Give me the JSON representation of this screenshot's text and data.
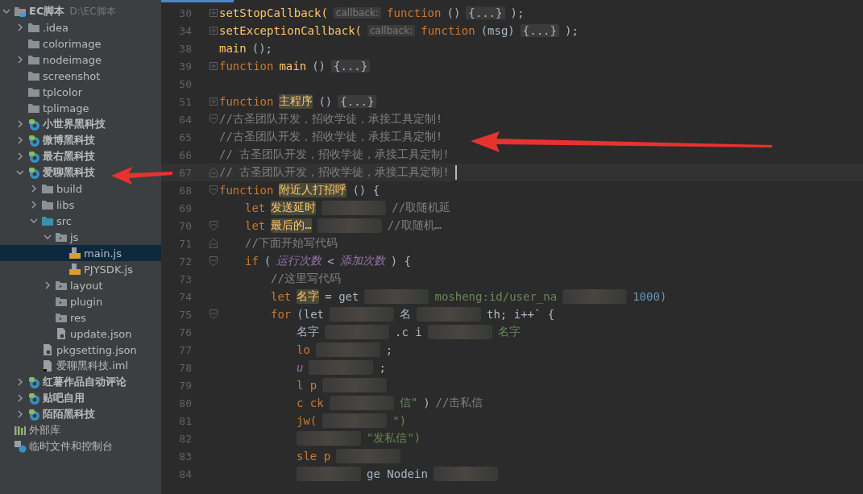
{
  "project_tree": [
    {
      "label": "EC脚本",
      "path": "D:\\EC脚本",
      "kind": "project",
      "expanded": true,
      "children": [
        {
          "label": ".idea",
          "kind": "folder",
          "expanded": false
        },
        {
          "label": "colorimage",
          "kind": "folder"
        },
        {
          "label": "nodeimage",
          "kind": "folder",
          "expanded": false
        },
        {
          "label": "screenshot",
          "kind": "folder"
        },
        {
          "label": "tplcolor",
          "kind": "folder"
        },
        {
          "label": "tplimage",
          "kind": "folder"
        },
        {
          "label": "小世界黑科技",
          "kind": "module",
          "expanded": false
        },
        {
          "label": "微博黑科技",
          "kind": "module",
          "expanded": false
        },
        {
          "label": "最右黑科技",
          "kind": "module",
          "expanded": false
        },
        {
          "label": "爱聊黑科技",
          "kind": "module",
          "expanded": true,
          "children": [
            {
              "label": "build",
              "kind": "folder",
              "expanded": false
            },
            {
              "label": "libs",
              "kind": "folder",
              "expanded": false
            },
            {
              "label": "src",
              "kind": "source",
              "expanded": true,
              "children": [
                {
                  "label": "js",
                  "kind": "package",
                  "expanded": true,
                  "children": [
                    {
                      "label": "main.js",
                      "kind": "js",
                      "selected": true
                    },
                    {
                      "label": "PJYSDK.js",
                      "kind": "js",
                      "selected": false
                    }
                  ]
                },
                {
                  "label": "layout",
                  "kind": "package",
                  "expanded": false
                },
                {
                  "label": "plugin",
                  "kind": "package"
                },
                {
                  "label": "res",
                  "kind": "package"
                },
                {
                  "label": "update.json",
                  "kind": "json"
                }
              ]
            },
            {
              "label": "pkgsetting.json",
              "kind": "json"
            },
            {
              "label": "爱聊黑科技.iml",
              "kind": "iml"
            }
          ]
        },
        {
          "label": "红薯作品自动评论",
          "kind": "module",
          "expanded": false
        },
        {
          "label": "贴吧自用",
          "kind": "module",
          "expanded": false
        },
        {
          "label": "陌陌黑科技",
          "kind": "module",
          "expanded": false
        }
      ]
    },
    {
      "label": "外部库",
      "kind": "library"
    },
    {
      "label": "临时文件和控制台",
      "kind": "scratch"
    }
  ],
  "code_lines": [
    {
      "number": "30",
      "kind": "collapsed",
      "current": false,
      "tokens": [
        {
          "kind": "call",
          "text": "setStopCallback("
        },
        {
          "kind": "hint",
          "text": "callback:"
        },
        {
          "kind": "keyword",
          "text": "function"
        },
        {
          "kind": "plain",
          "text": "()"
        },
        {
          "kind": "folded",
          "text": "{...}"
        },
        {
          "kind": "plain",
          "text": ");"
        }
      ]
    },
    {
      "number": "34",
      "kind": "collapsed",
      "current": false,
      "tokens": [
        {
          "kind": "call",
          "text": "setExceptionCallback("
        },
        {
          "kind": "hint",
          "text": "callback:"
        },
        {
          "kind": "keyword",
          "text": "function"
        },
        {
          "kind": "plain",
          "text": "(msg)"
        },
        {
          "kind": "folded",
          "text": "{...}"
        },
        {
          "kind": "plain",
          "text": ");"
        }
      ]
    },
    {
      "number": "38",
      "current": false,
      "tokens": [
        {
          "kind": "call",
          "text": "main"
        },
        {
          "kind": "plain",
          "text": "();"
        }
      ]
    },
    {
      "number": "39",
      "kind": "collapsed",
      "current": false,
      "tokens": [
        {
          "kind": "keyword",
          "text": "function"
        },
        {
          "kind": "call",
          "text": "main"
        },
        {
          "kind": "plain",
          "text": "()"
        },
        {
          "kind": "folded",
          "text": "{...}"
        }
      ]
    },
    {
      "number": "50",
      "current": false
    },
    {
      "number": "51",
      "kind": "collapsed",
      "current": false,
      "tokens": [
        {
          "kind": "keyword",
          "text": "function"
        },
        {
          "kind": "marked",
          "text": "主程序"
        },
        {
          "kind": "plain",
          "text": "()"
        },
        {
          "kind": "folded",
          "text": "{...}"
        }
      ]
    },
    {
      "number": "64",
      "kind": "opening",
      "current": false,
      "tokens": [
        {
          "kind": "comment",
          "text": "//古圣团队开发，招收学徒，承接工具定制!"
        }
      ]
    },
    {
      "number": "65",
      "current": false,
      "tokens": [
        {
          "kind": "comment",
          "text": "//古圣团队开发，招收学徒，承接工具定制!"
        }
      ]
    },
    {
      "number": "66",
      "current": false,
      "tokens": [
        {
          "kind": "comment",
          "text": "// 古圣团队开发，招收学徒，承接工具定制!"
        }
      ]
    },
    {
      "number": "67",
      "kind": "closing",
      "current": true,
      "tokens": [
        {
          "kind": "comment",
          "text": "// 古圣团队开发，招收学徒，承接工具定制!"
        }
      ]
    },
    {
      "number": "68",
      "kind": "opening",
      "current": false,
      "tokens": [
        {
          "kind": "keyword",
          "text": "function"
        },
        {
          "kind": "marked",
          "text": "附近人打招呼"
        },
        {
          "kind": "plain",
          "text": "() {"
        }
      ],
      "children": [
        {
          "number": "69",
          "current": false,
          "tokens": [
            {
              "kind": "keyword",
              "text": "let"
            },
            {
              "kind": "marked",
              "text": "发送延时"
            },
            {
              "kind": "redacted"
            },
            {
              "kind": "comment",
              "text": "//取随机延"
            }
          ]
        },
        {
          "number": "70",
          "kind": "opening",
          "current": false,
          "tokens": [
            {
              "kind": "keyword",
              "text": "let"
            },
            {
              "kind": "marked",
              "text": "最后的…"
            },
            {
              "kind": "redacted"
            },
            {
              "kind": "comment",
              "text": "//取随机…"
            }
          ]
        },
        {
          "number": "71",
          "kind": "closing",
          "current": false,
          "tokens": [
            {
              "kind": "comment",
              "text": "//下面开始写代码"
            }
          ]
        },
        {
          "number": "72",
          "kind": "opening",
          "current": false,
          "tokens": [
            {
              "kind": "keyword",
              "text": "if"
            },
            {
              "kind": "plain",
              "text": "("
            },
            {
              "kind": "global",
              "text": "运行次数"
            },
            {
              "kind": "plain",
              "text": "<"
            },
            {
              "kind": "global",
              "text": "添加次数"
            },
            {
              "kind": "plain",
              "text": ") {"
            }
          ],
          "children": [
            {
              "number": "73",
              "current": false,
              "tokens": [
                {
                  "kind": "comment",
                  "text": "//这里写代码"
                }
              ]
            },
            {
              "number": "74",
              "current": false,
              "tokens": [
                {
                  "kind": "keyword",
                  "text": "let"
                },
                {
                  "kind": "marked",
                  "text": "名字"
                },
                {
                  "kind": "plain",
                  "text": "= get"
                },
                {
                  "kind": "redacted"
                },
                {
                  "kind": "string",
                  "text": "mosheng:id/user_na"
                },
                {
                  "kind": "redacted"
                },
                {
                  "kind": "number",
                  "text": "1000)"
                }
              ]
            },
            {
              "number": "75",
              "kind": "opening",
              "current": false,
              "tokens": [
                {
                  "kind": "keyword",
                  "text": "for"
                },
                {
                  "kind": "plain",
                  "text": "(let"
                },
                {
                  "kind": "redacted"
                },
                {
                  "kind": "plain",
                  "text": "名"
                },
                {
                  "kind": "redacted"
                },
                {
                  "kind": "plain",
                  "text": "th; i++` {"
                }
              ],
              "children": [
                {
                  "number": "76",
                  "current": false,
                  "tokens": [
                    {
                      "kind": "plain",
                      "text": "名字"
                    },
                    {
                      "kind": "redacted"
                    },
                    {
                      "kind": "plain",
                      "text": ".c i"
                    },
                    {
                      "kind": "redacted"
                    },
                    {
                      "kind": "string",
                      "text": "名字"
                    }
                  ]
                },
                {
                  "number": "77",
                  "current": false,
                  "tokens": [
                    {
                      "kind": "keyword",
                      "text": "lo"
                    },
                    {
                      "kind": "redacted"
                    },
                    {
                      "kind": "plain",
                      "text": ";"
                    }
                  ]
                },
                {
                  "number": "78",
                  "current": false,
                  "tokens": [
                    {
                      "kind": "global",
                      "text": "u"
                    },
                    {
                      "kind": "redacted"
                    },
                    {
                      "kind": "plain",
                      "text": ";"
                    }
                  ]
                },
                {
                  "number": "79",
                  "current": false,
                  "tokens": [
                    {
                      "kind": "keyword",
                      "text": "l p"
                    },
                    {
                      "kind": "redacted"
                    }
                  ]
                },
                {
                  "number": "80",
                  "current": false,
                  "tokens": [
                    {
                      "kind": "keyword",
                      "text": "c ck"
                    },
                    {
                      "kind": "redacted"
                    },
                    {
                      "kind": "string",
                      "text": "信\""
                    },
                    {
                      "kind": "plain",
                      "text": ")"
                    },
                    {
                      "kind": "comment",
                      "text": "//击私信"
                    }
                  ]
                },
                {
                  "number": "81",
                  "current": false,
                  "tokens": [
                    {
                      "kind": "keyword",
                      "text": "jw("
                    },
                    {
                      "kind": "redacted"
                    },
                    {
                      "kind": "string",
                      "text": "\")"
                    }
                  ]
                },
                {
                  "number": "82",
                  "current": false,
                  "tokens": [
                    {
                      "kind": "redacted"
                    },
                    {
                      "kind": "string",
                      "text": "\"发私信\")"
                    }
                  ]
                },
                {
                  "number": "83",
                  "current": false,
                  "tokens": [
                    {
                      "kind": "keyword",
                      "text": "sle p"
                    },
                    {
                      "kind": "redacted"
                    }
                  ]
                },
                {
                  "number": "84",
                  "current": false,
                  "tokens": [
                    {
                      "kind": "redacted"
                    },
                    {
                      "kind": "plain",
                      "text": "ge Nodein"
                    },
                    {
                      "kind": "redacted"
                    }
                  ]
                }
              ]
            }
          ]
        }
      ]
    }
  ]
}
